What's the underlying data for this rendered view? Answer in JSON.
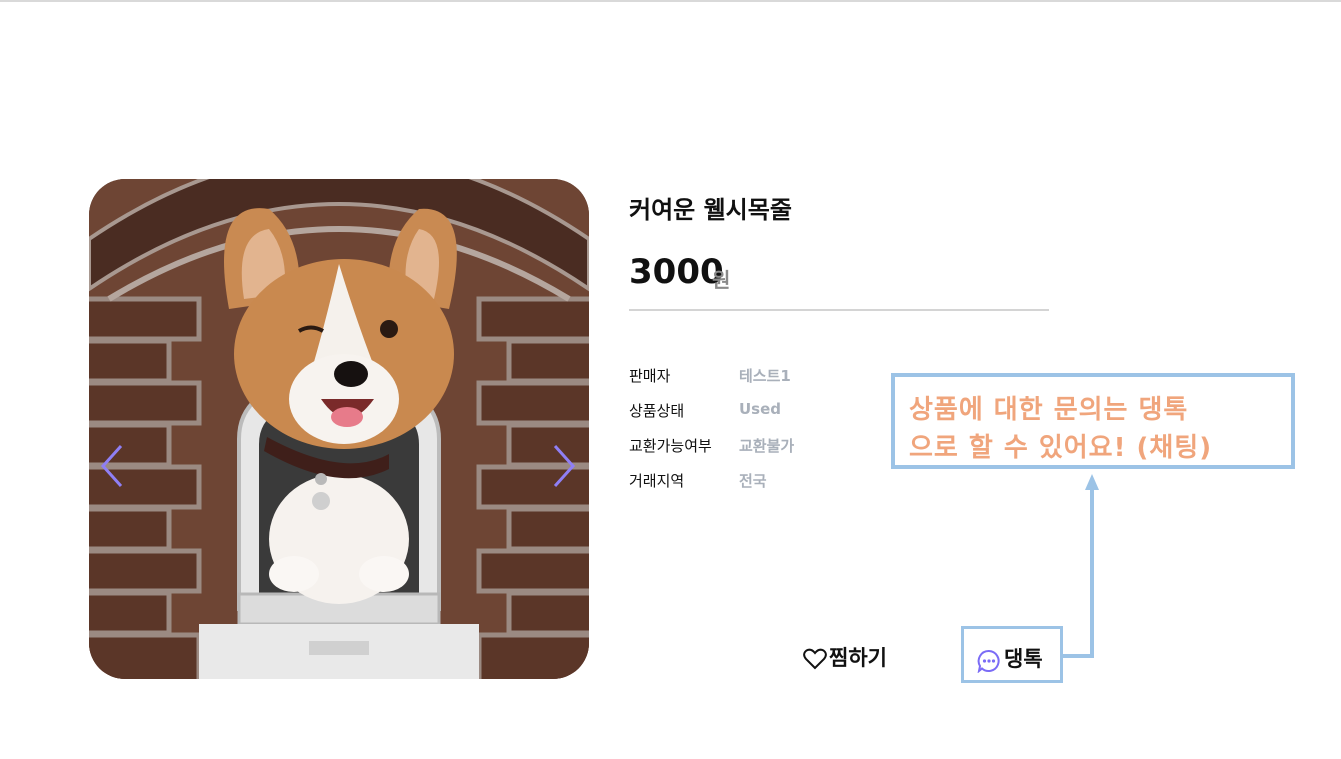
{
  "product": {
    "title": "커여운 웰시목줄",
    "price": "3000",
    "price_unit": "원",
    "image_alt": "웰시코기 강아지 사진"
  },
  "details": [
    {
      "label": "판매자",
      "value": "테스트1"
    },
    {
      "label": "상품상태",
      "value": "Used"
    },
    {
      "label": "교환가능여부",
      "value": "교환불가"
    },
    {
      "label": "거래지역",
      "value": "전국"
    }
  ],
  "actions": {
    "wish_label": "찜하기",
    "wish_icon": "heart-outline-icon",
    "chat_label": "댕톡",
    "chat_icon": "chat-bubble-icon"
  },
  "carousel": {
    "prev_icon": "chevron-left-icon",
    "next_icon": "chevron-right-icon"
  },
  "annotation": {
    "line1": "상품에 대한 문의는 댕톡",
    "line2": "으로 할 수 있어요! (채팅)"
  },
  "colors": {
    "annotation_text": "#f0a57c",
    "annotation_border": "#9cc3e6",
    "detail_value": "#a9b0ba",
    "chat_icon": "#7b6cf6",
    "arrow": "#8f7ff5"
  }
}
